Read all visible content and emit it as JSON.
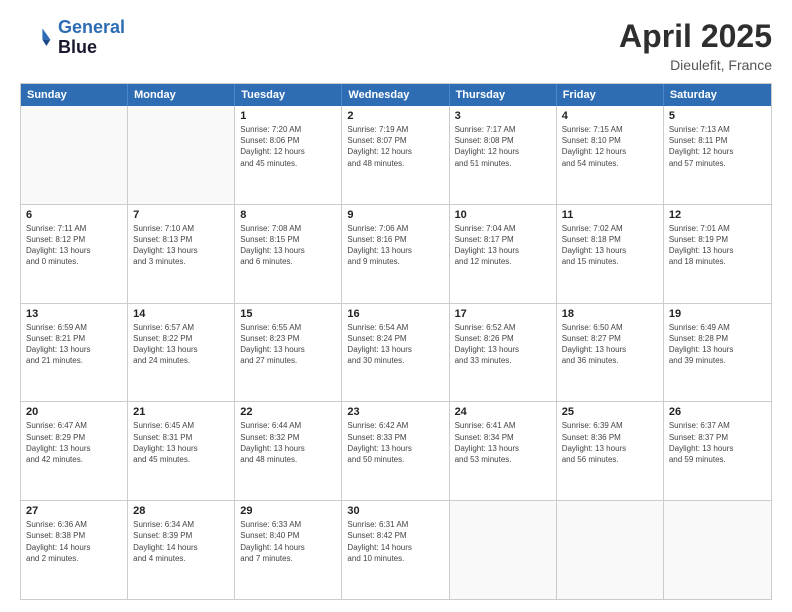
{
  "header": {
    "logo_line1": "General",
    "logo_line2": "Blue",
    "main_title": "April 2025",
    "subtitle": "Dieulefit, France"
  },
  "days_of_week": [
    "Sunday",
    "Monday",
    "Tuesday",
    "Wednesday",
    "Thursday",
    "Friday",
    "Saturday"
  ],
  "weeks": [
    [
      {
        "day": "",
        "info": ""
      },
      {
        "day": "",
        "info": ""
      },
      {
        "day": "1",
        "info": "Sunrise: 7:20 AM\nSunset: 8:06 PM\nDaylight: 12 hours\nand 45 minutes."
      },
      {
        "day": "2",
        "info": "Sunrise: 7:19 AM\nSunset: 8:07 PM\nDaylight: 12 hours\nand 48 minutes."
      },
      {
        "day": "3",
        "info": "Sunrise: 7:17 AM\nSunset: 8:08 PM\nDaylight: 12 hours\nand 51 minutes."
      },
      {
        "day": "4",
        "info": "Sunrise: 7:15 AM\nSunset: 8:10 PM\nDaylight: 12 hours\nand 54 minutes."
      },
      {
        "day": "5",
        "info": "Sunrise: 7:13 AM\nSunset: 8:11 PM\nDaylight: 12 hours\nand 57 minutes."
      }
    ],
    [
      {
        "day": "6",
        "info": "Sunrise: 7:11 AM\nSunset: 8:12 PM\nDaylight: 13 hours\nand 0 minutes."
      },
      {
        "day": "7",
        "info": "Sunrise: 7:10 AM\nSunset: 8:13 PM\nDaylight: 13 hours\nand 3 minutes."
      },
      {
        "day": "8",
        "info": "Sunrise: 7:08 AM\nSunset: 8:15 PM\nDaylight: 13 hours\nand 6 minutes."
      },
      {
        "day": "9",
        "info": "Sunrise: 7:06 AM\nSunset: 8:16 PM\nDaylight: 13 hours\nand 9 minutes."
      },
      {
        "day": "10",
        "info": "Sunrise: 7:04 AM\nSunset: 8:17 PM\nDaylight: 13 hours\nand 12 minutes."
      },
      {
        "day": "11",
        "info": "Sunrise: 7:02 AM\nSunset: 8:18 PM\nDaylight: 13 hours\nand 15 minutes."
      },
      {
        "day": "12",
        "info": "Sunrise: 7:01 AM\nSunset: 8:19 PM\nDaylight: 13 hours\nand 18 minutes."
      }
    ],
    [
      {
        "day": "13",
        "info": "Sunrise: 6:59 AM\nSunset: 8:21 PM\nDaylight: 13 hours\nand 21 minutes."
      },
      {
        "day": "14",
        "info": "Sunrise: 6:57 AM\nSunset: 8:22 PM\nDaylight: 13 hours\nand 24 minutes."
      },
      {
        "day": "15",
        "info": "Sunrise: 6:55 AM\nSunset: 8:23 PM\nDaylight: 13 hours\nand 27 minutes."
      },
      {
        "day": "16",
        "info": "Sunrise: 6:54 AM\nSunset: 8:24 PM\nDaylight: 13 hours\nand 30 minutes."
      },
      {
        "day": "17",
        "info": "Sunrise: 6:52 AM\nSunset: 8:26 PM\nDaylight: 13 hours\nand 33 minutes."
      },
      {
        "day": "18",
        "info": "Sunrise: 6:50 AM\nSunset: 8:27 PM\nDaylight: 13 hours\nand 36 minutes."
      },
      {
        "day": "19",
        "info": "Sunrise: 6:49 AM\nSunset: 8:28 PM\nDaylight: 13 hours\nand 39 minutes."
      }
    ],
    [
      {
        "day": "20",
        "info": "Sunrise: 6:47 AM\nSunset: 8:29 PM\nDaylight: 13 hours\nand 42 minutes."
      },
      {
        "day": "21",
        "info": "Sunrise: 6:45 AM\nSunset: 8:31 PM\nDaylight: 13 hours\nand 45 minutes."
      },
      {
        "day": "22",
        "info": "Sunrise: 6:44 AM\nSunset: 8:32 PM\nDaylight: 13 hours\nand 48 minutes."
      },
      {
        "day": "23",
        "info": "Sunrise: 6:42 AM\nSunset: 8:33 PM\nDaylight: 13 hours\nand 50 minutes."
      },
      {
        "day": "24",
        "info": "Sunrise: 6:41 AM\nSunset: 8:34 PM\nDaylight: 13 hours\nand 53 minutes."
      },
      {
        "day": "25",
        "info": "Sunrise: 6:39 AM\nSunset: 8:36 PM\nDaylight: 13 hours\nand 56 minutes."
      },
      {
        "day": "26",
        "info": "Sunrise: 6:37 AM\nSunset: 8:37 PM\nDaylight: 13 hours\nand 59 minutes."
      }
    ],
    [
      {
        "day": "27",
        "info": "Sunrise: 6:36 AM\nSunset: 8:38 PM\nDaylight: 14 hours\nand 2 minutes."
      },
      {
        "day": "28",
        "info": "Sunrise: 6:34 AM\nSunset: 8:39 PM\nDaylight: 14 hours\nand 4 minutes."
      },
      {
        "day": "29",
        "info": "Sunrise: 6:33 AM\nSunset: 8:40 PM\nDaylight: 14 hours\nand 7 minutes."
      },
      {
        "day": "30",
        "info": "Sunrise: 6:31 AM\nSunset: 8:42 PM\nDaylight: 14 hours\nand 10 minutes."
      },
      {
        "day": "",
        "info": ""
      },
      {
        "day": "",
        "info": ""
      },
      {
        "day": "",
        "info": ""
      }
    ]
  ]
}
